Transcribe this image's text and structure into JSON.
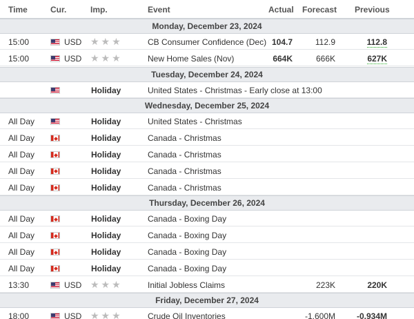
{
  "header": {
    "time": "Time",
    "currency": "Cur.",
    "importance": "Imp.",
    "event": "Event",
    "actual": "Actual",
    "forecast": "Forecast",
    "previous": "Previous"
  },
  "days": [
    {
      "label": "Monday, December 23, 2024",
      "events": [
        {
          "time": "15:00",
          "flag": "us",
          "currency": "USD",
          "importance": 3,
          "event": "CB Consumer Confidence (Dec)",
          "actual": "104.7",
          "actual_style": "red",
          "forecast": "112.9",
          "previous": "112.8",
          "previous_style": "green"
        },
        {
          "time": "15:00",
          "flag": "us",
          "currency": "USD",
          "importance": 3,
          "event": "New Home Sales (Nov)",
          "actual": "664K",
          "actual_style": "red",
          "forecast": "666K",
          "previous": "627K",
          "previous_style": "green"
        }
      ]
    },
    {
      "label": "Tuesday, December 24, 2024",
      "events": [
        {
          "time": "",
          "flag": "us",
          "currency": "",
          "holiday": "Holiday",
          "event": "United States - Christmas - Early close at 13:00"
        }
      ]
    },
    {
      "label": "Wednesday, December 25, 2024",
      "events": [
        {
          "time": "All Day",
          "flag": "us",
          "currency": "",
          "holiday": "Holiday",
          "event": "United States - Christmas"
        },
        {
          "time": "All Day",
          "flag": "ca",
          "currency": "",
          "holiday": "Holiday",
          "event": "Canada - Christmas"
        },
        {
          "time": "All Day",
          "flag": "ca",
          "currency": "",
          "holiday": "Holiday",
          "event": "Canada - Christmas"
        },
        {
          "time": "All Day",
          "flag": "ca",
          "currency": "",
          "holiday": "Holiday",
          "event": "Canada - Christmas"
        },
        {
          "time": "All Day",
          "flag": "ca",
          "currency": "",
          "holiday": "Holiday",
          "event": "Canada - Christmas"
        }
      ]
    },
    {
      "label": "Thursday, December 26, 2024",
      "events": [
        {
          "time": "All Day",
          "flag": "ca",
          "currency": "",
          "holiday": "Holiday",
          "event": "Canada - Boxing Day"
        },
        {
          "time": "All Day",
          "flag": "ca",
          "currency": "",
          "holiday": "Holiday",
          "event": "Canada - Boxing Day"
        },
        {
          "time": "All Day",
          "flag": "ca",
          "currency": "",
          "holiday": "Holiday",
          "event": "Canada - Boxing Day"
        },
        {
          "time": "All Day",
          "flag": "ca",
          "currency": "",
          "holiday": "Holiday",
          "event": "Canada - Boxing Day"
        },
        {
          "time": "13:30",
          "flag": "us",
          "currency": "USD",
          "importance": 3,
          "event": "Initial Jobless Claims",
          "actual": "",
          "forecast": "223K",
          "previous": "220K",
          "previous_style": "bold"
        }
      ]
    },
    {
      "label": "Friday, December 27, 2024",
      "events": [
        {
          "time": "18:00",
          "flag": "us",
          "currency": "USD",
          "importance": 3,
          "event": "Crude Oil Inventories",
          "actual": "",
          "forecast": "-1.600M",
          "previous": "-0.934M",
          "previous_style": "bold"
        }
      ]
    }
  ]
}
